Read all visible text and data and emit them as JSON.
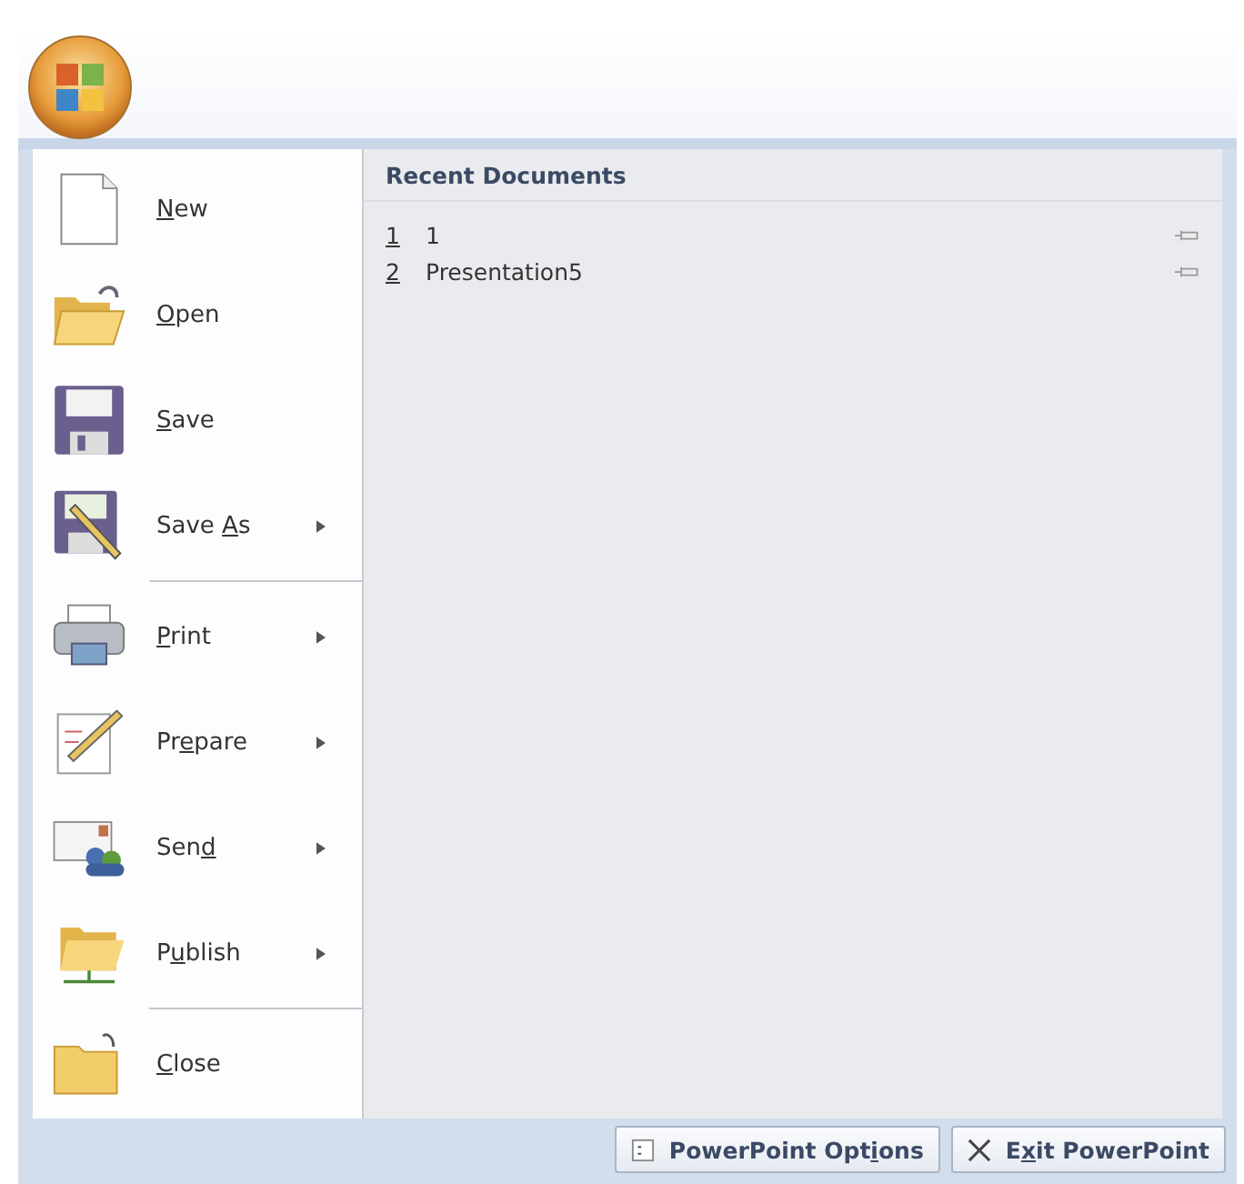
{
  "menu_items": [
    {
      "kind": "new",
      "key": "N",
      "post": "ew",
      "submenu": false,
      "separator_after": false
    },
    {
      "kind": "open",
      "key": "O",
      "post": "pen",
      "submenu": false,
      "separator_after": false
    },
    {
      "kind": "save",
      "key": "S",
      "post": "ave",
      "submenu": false,
      "separator_after": false
    },
    {
      "kind": "saveas",
      "pre": "Save ",
      "key": "A",
      "post": "s",
      "submenu": true,
      "separator_after": true
    },
    {
      "kind": "print",
      "key": "P",
      "post": "rint",
      "submenu": true,
      "separator_after": false
    },
    {
      "kind": "prepare",
      "pre": "Pr",
      "key": "e",
      "post": "pare",
      "submenu": true,
      "separator_after": false
    },
    {
      "kind": "send",
      "pre": "Sen",
      "key": "d",
      "submenu": true,
      "separator_after": false
    },
    {
      "kind": "publish",
      "pre": "P",
      "key": "u",
      "post": "blish",
      "submenu": true,
      "separator_after": true
    },
    {
      "kind": "close",
      "key": "C",
      "post": "lose",
      "submenu": false,
      "separator_after": false
    }
  ],
  "recent_documents": {
    "title": "Recent Documents",
    "items": [
      {
        "number": "1",
        "name": "1"
      },
      {
        "number": "2",
        "name": "Presentation5"
      }
    ]
  },
  "footer_buttons": [
    {
      "kind": "options",
      "pre": "PowerPoint Opt",
      "key": "i",
      "post": "ons"
    },
    {
      "kind": "exit",
      "pre": "E",
      "key": "x",
      "post": "it PowerPoint"
    }
  ]
}
